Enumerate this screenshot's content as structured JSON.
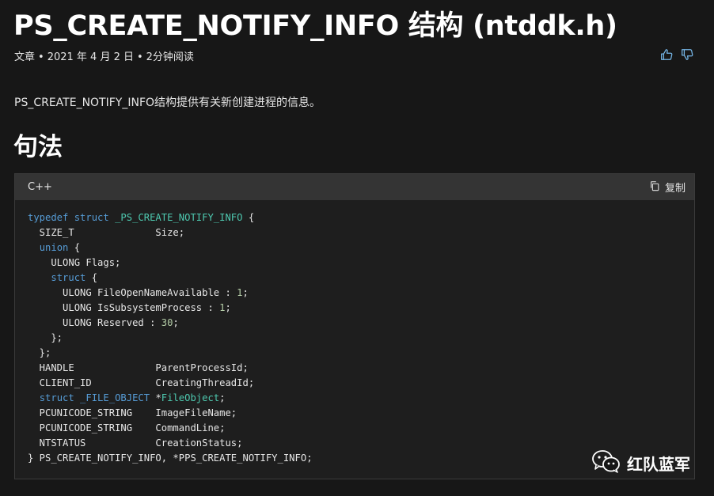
{
  "header": {
    "title": "PS_CREATE_NOTIFY_INFO 结构 (ntddk.h)",
    "meta": {
      "type": "文章",
      "date": "2021 年 4 月 2 日",
      "read_time": "2分钟阅读",
      "separator": "•"
    }
  },
  "feedback": {
    "like_icon": "thumbs-up-icon",
    "dislike_icon": "thumbs-down-icon",
    "accent": "#75b6e7"
  },
  "description": "PS_CREATE_NOTIFY_INFO结构提供有关新创建进程的信息。",
  "syntax": {
    "heading": "句法",
    "language": "C++",
    "copy_label": "复制",
    "copy_icon": "copy-icon",
    "lines": [
      [
        {
          "t": "typedef struct ",
          "c": "kw"
        },
        {
          "t": "_PS_CREATE_NOTIFY_INFO",
          "c": "type"
        },
        {
          "t": " {",
          "c": "plain"
        }
      ],
      [
        {
          "t": "  SIZE_T              Size;",
          "c": "plain"
        }
      ],
      [
        {
          "t": "  ",
          "c": "plain"
        },
        {
          "t": "union",
          "c": "kw"
        },
        {
          "t": " {",
          "c": "plain"
        }
      ],
      [
        {
          "t": "    ULONG Flags;",
          "c": "plain"
        }
      ],
      [
        {
          "t": "    ",
          "c": "plain"
        },
        {
          "t": "struct",
          "c": "kw"
        },
        {
          "t": " {",
          "c": "plain"
        }
      ],
      [
        {
          "t": "      ULONG FileOpenNameAvailable : ",
          "c": "plain"
        },
        {
          "t": "1",
          "c": "num"
        },
        {
          "t": ";",
          "c": "plain"
        }
      ],
      [
        {
          "t": "      ULONG IsSubsystemProcess : ",
          "c": "plain"
        },
        {
          "t": "1",
          "c": "num"
        },
        {
          "t": ";",
          "c": "plain"
        }
      ],
      [
        {
          "t": "      ULONG Reserved : ",
          "c": "plain"
        },
        {
          "t": "30",
          "c": "num"
        },
        {
          "t": ";",
          "c": "plain"
        }
      ],
      [
        {
          "t": "    };",
          "c": "plain"
        }
      ],
      [
        {
          "t": "  };",
          "c": "plain"
        }
      ],
      [
        {
          "t": "  HANDLE              ParentProcessId;",
          "c": "plain"
        }
      ],
      [
        {
          "t": "  CLIENT_ID           CreatingThreadId;",
          "c": "plain"
        }
      ],
      [
        {
          "t": "  ",
          "c": "plain"
        },
        {
          "t": "struct _FILE_OBJECT ",
          "c": "kw"
        },
        {
          "t": "*",
          "c": "plain"
        },
        {
          "t": "FileObject",
          "c": "type"
        },
        {
          "t": ";",
          "c": "plain"
        }
      ],
      [
        {
          "t": "  PCUNICODE_STRING    ImageFileName;",
          "c": "plain"
        }
      ],
      [
        {
          "t": "  PCUNICODE_STRING    CommandLine;",
          "c": "plain"
        }
      ],
      [
        {
          "t": "  NTSTATUS            CreationStatus;",
          "c": "plain"
        }
      ],
      [
        {
          "t": "} PS_CREATE_NOTIFY_INFO, *PPS_CREATE_NOTIFY_INFO;",
          "c": "plain"
        }
      ]
    ]
  },
  "watermark": {
    "text": "红队蓝军",
    "icon": "wechat-icon"
  }
}
